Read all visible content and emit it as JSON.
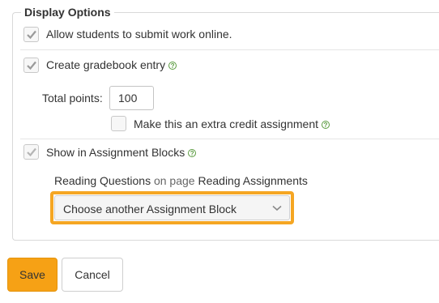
{
  "section": {
    "legend": "Display Options"
  },
  "options": {
    "allow_online": {
      "label": "Allow students to submit work online.",
      "checked": true
    },
    "gradebook": {
      "label": "Create gradebook entry",
      "checked": true,
      "help": "?"
    },
    "total_points": {
      "label": "Total points:",
      "value": "100"
    },
    "extra_credit": {
      "label": "Make this an extra credit assignment",
      "checked": false,
      "help": "?"
    },
    "assignment_blocks": {
      "label": "Show in Assignment Blocks",
      "checked": true,
      "help": "?"
    }
  },
  "block_info": {
    "block": "Reading Questions",
    "connector": "on page",
    "page": "Reading Assignments"
  },
  "block_select": {
    "selected": "Choose another Assignment Block"
  },
  "actions": {
    "save": "Save",
    "cancel": "Cancel"
  },
  "colors": {
    "accent": "#f6a115",
    "highlight": "#f5a623",
    "help": "#5a9b3f"
  }
}
